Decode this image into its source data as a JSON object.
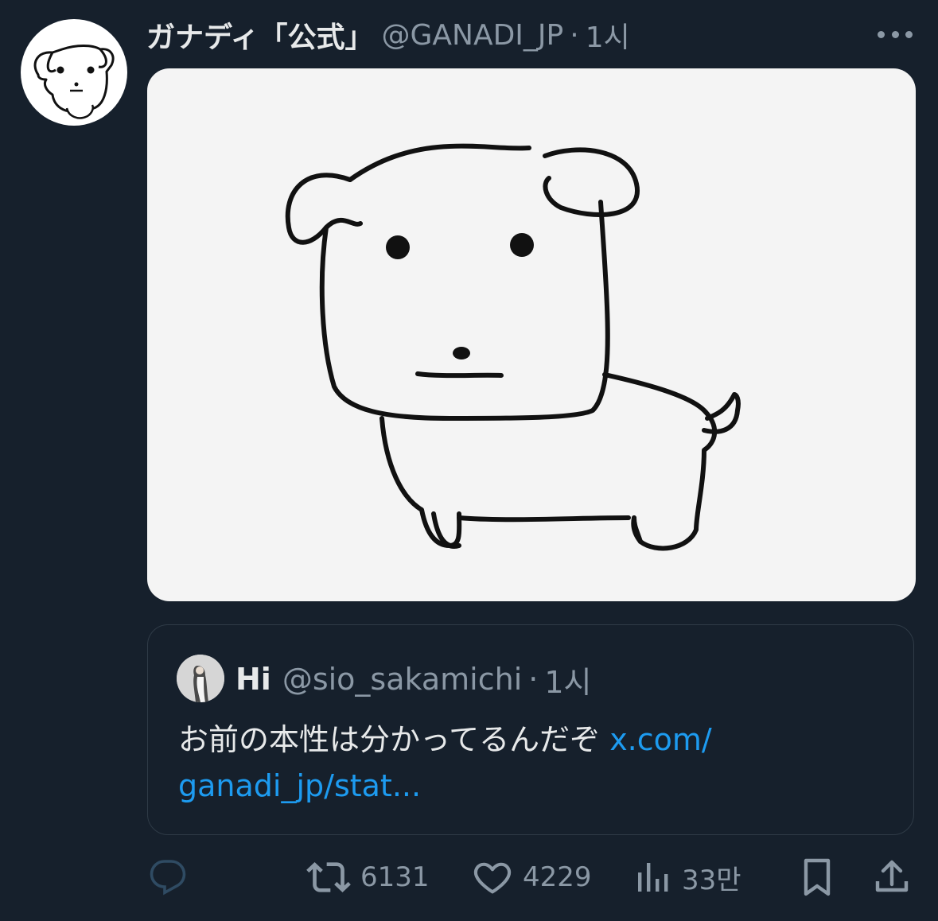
{
  "post": {
    "author_name": "ガナディ「公式」",
    "author_handle": "@GANADI_JP",
    "separator": "·",
    "time": "1시",
    "avatar_icon": "dog-avatar-icon",
    "more_icon": "more-horizontal-icon"
  },
  "media": {
    "icon": "white-dog-illustration"
  },
  "quote": {
    "author_name": "Hi",
    "author_handle": "@sio_sakamichi",
    "separator": "·",
    "time": "1시",
    "text": "お前の本性は分かってるんだぞ ",
    "link_line1": "x.com/",
    "link_line2": "ganadi_jp/stat..."
  },
  "actions": {
    "reply_icon": "reply-icon",
    "retweet_icon": "retweet-icon",
    "retweet_count": "6131",
    "like_icon": "heart-icon",
    "like_count": "4229",
    "views_icon": "views-chart-icon",
    "views_count": "33만",
    "bookmark_icon": "bookmark-icon",
    "share_icon": "share-icon"
  },
  "colors": {
    "background": "#16202c",
    "text": "#e7e9ea",
    "secondary": "#8b98a5",
    "link": "#1d9bf0",
    "border": "#2f3b47"
  }
}
